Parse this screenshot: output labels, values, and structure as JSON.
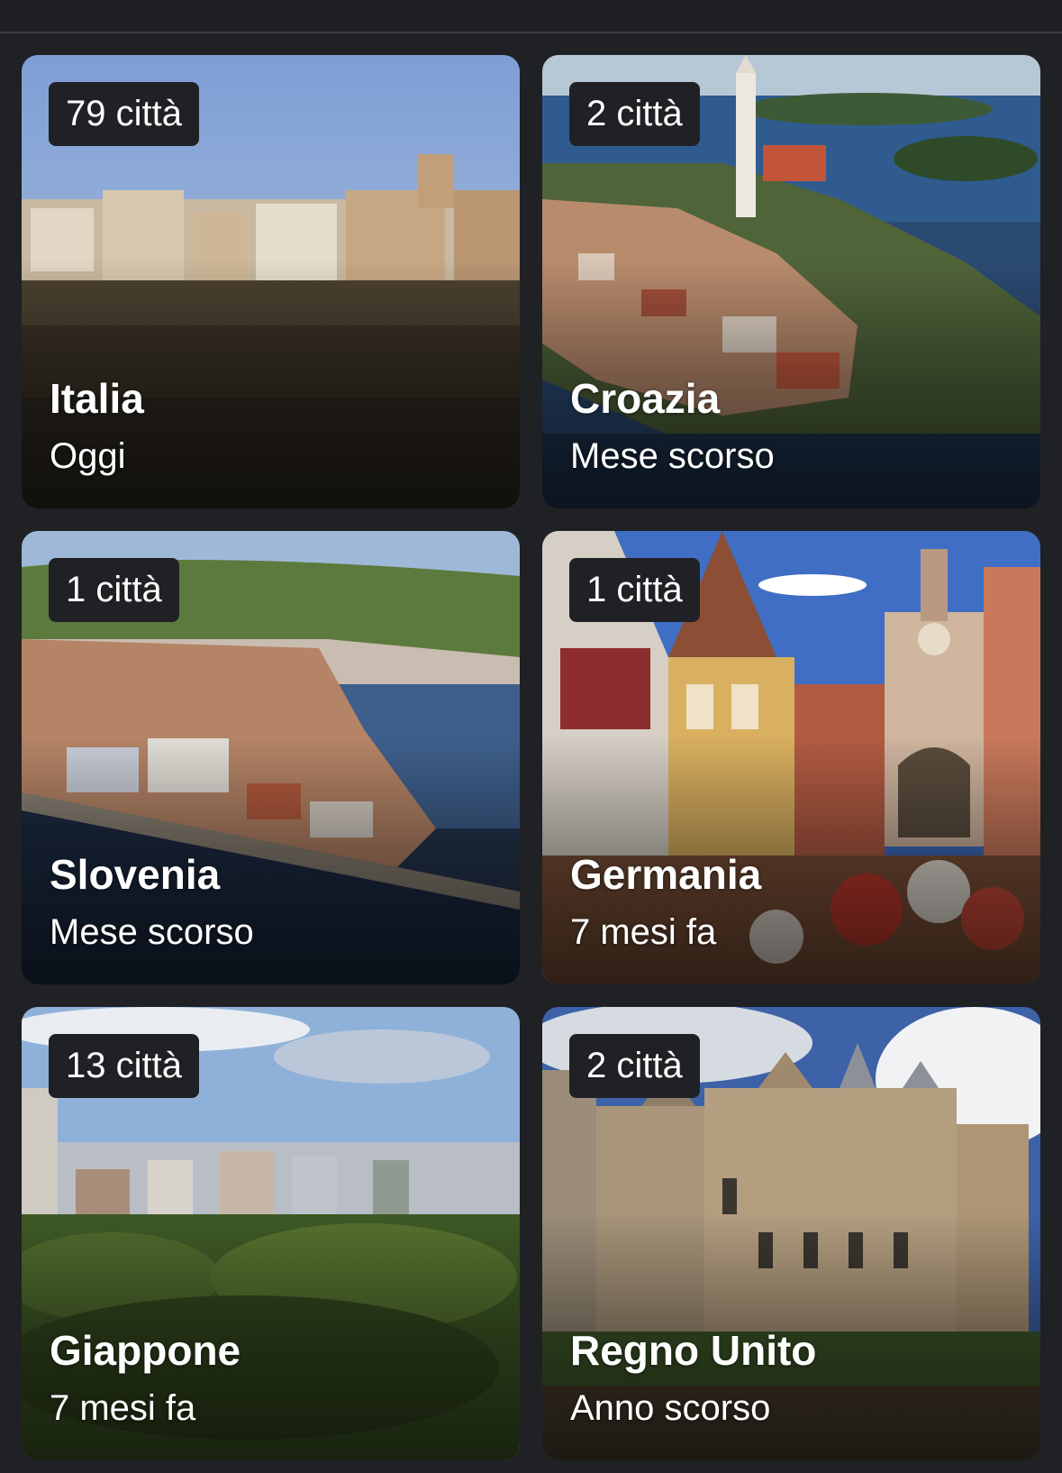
{
  "cards": [
    {
      "badge": "79 città",
      "title": "Italia",
      "subtitle": "Oggi",
      "image": "photo-coastal-cliff-town"
    },
    {
      "badge": "2 città",
      "title": "Croazia",
      "subtitle": "Mese scorso",
      "image": "photo-peninsula-old-town"
    },
    {
      "badge": "1 città",
      "title": "Slovenia",
      "subtitle": "Mese scorso",
      "image": "photo-seaside-town-bay"
    },
    {
      "badge": "1 città",
      "title": "Germania",
      "subtitle": "7 mesi fa",
      "image": "photo-half-timbered-street"
    },
    {
      "badge": "13 città",
      "title": "Giappone",
      "subtitle": "7 mesi fa",
      "image": "photo-city-skyline-park"
    },
    {
      "badge": "2 città",
      "title": "Regno Unito",
      "subtitle": "Anno scorso",
      "image": "photo-castle-garden"
    }
  ]
}
